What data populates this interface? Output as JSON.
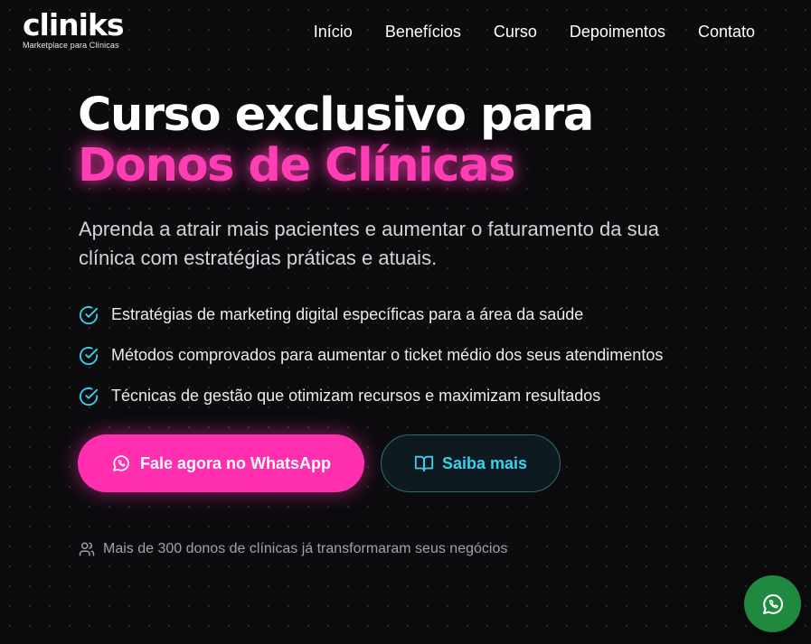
{
  "brand": {
    "name": "cliniks",
    "tagline": "Marketplace para Clínicas"
  },
  "nav": {
    "items": [
      {
        "label": "Início"
      },
      {
        "label": "Benefícios"
      },
      {
        "label": "Curso"
      },
      {
        "label": "Depoimentos"
      },
      {
        "label": "Contato"
      }
    ]
  },
  "hero": {
    "title_line1": "Curso exclusivo para",
    "title_line2": "Donos de Clínicas",
    "subtitle": "Aprenda a atrair mais pacientes e aumentar o faturamento da sua clínica com estratégias práticas e atuais."
  },
  "features": [
    {
      "text": "Estratégias de marketing digital específicas para a área da saúde",
      "icon": "check-circle-icon"
    },
    {
      "text": "Métodos comprovados para aumentar o ticket médio dos seus atendimentos",
      "icon": "check-circle-icon"
    },
    {
      "text": "Técnicas de gestão que otimizam recursos e maximizam resultados",
      "icon": "check-circle-icon"
    }
  ],
  "cta": {
    "primary_label": "Fale agora no WhatsApp",
    "primary_icon": "whatsapp-icon",
    "secondary_label": "Saiba mais",
    "secondary_icon": "book-icon"
  },
  "social_proof": {
    "text": "Mais de 300 donos de clínicas já transformaram seus negócios",
    "icon": "users-icon"
  },
  "floating_button": {
    "icon": "whatsapp-icon"
  },
  "colors": {
    "background": "#0c0b0e",
    "accent_pink": "#ff2fb0",
    "accent_cyan": "#35d3ef",
    "whatsapp_green": "#1f8a3f"
  }
}
